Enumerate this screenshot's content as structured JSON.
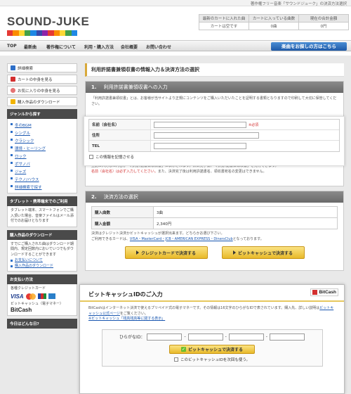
{
  "topline": "著作権フリー音楽「サウンドジューク」の決済方法選択",
  "logo": "SOUND-JUKE",
  "logo_colors": [
    "#e53935",
    "#fb8c00",
    "#fdd835",
    "#43a047",
    "#1e88e5",
    "#3949ab",
    "#8e24aa",
    "#e53935",
    "#fb8c00",
    "#fdd835",
    "#43a047",
    "#1e88e5"
  ],
  "status": {
    "headers": [
      "最新のカートに入れた曲",
      "カートに入っている曲数",
      "現在の合計金額"
    ],
    "values": [
      "カートは空です",
      "0曲",
      "0円"
    ]
  },
  "nav": {
    "items": [
      "TOP",
      "最新曲",
      "著作権について",
      "利用・購入方法",
      "会社概要",
      "お問い合わせ"
    ],
    "search": "楽曲をお探しの方はこちら"
  },
  "sidebar": {
    "buttons": [
      "詳細検索",
      "カートの中身を見る",
      "お気に入りの中身を見る",
      "購入作品のダウンロード"
    ],
    "genre_title": "ジャンルから探す",
    "genres": [
      "冬のBGM",
      "シングル",
      "クラシック",
      "環境・ヒーリング",
      "ロック",
      "ポサノバ",
      "ジャズ",
      "テクノ/ハウス",
      "詳細検索で探す"
    ],
    "tablet_title": "タブレット・携帯端末でのご利用",
    "tablet_text": "タブレット端末、スマートフォンでご購入頂いた場合、音楽ファイルはメール添付でのお届けとなります",
    "download_title": "購入作品のダウンロード",
    "download_text": "すでにご購入された曲はダウンロード期間内、規定回数内においていつでもダウンロードすることができます",
    "download_links": [
      "お支払いについて",
      "購入作品のダウンロード"
    ],
    "pay_title": "お支払い方法",
    "card_label": "各種クレジットカード",
    "visa": "VISA",
    "bitcash_label": "ビットキャッシュ（電子マネー）",
    "bitcash": "BitCash",
    "today_title": "今日はどんな日?"
  },
  "main": {
    "title": "利用許諾書兼領収書の情報入力＆決済方法の選択",
    "step1_num": "1.",
    "step1_title": "利用許諾書兼領収書への入力",
    "step1_desc": "「利用許諾書兼領収書」とは、お客様が当サイトより正規にコンテンツをご購入いただいたことを証明する書類となりますので印刷して大切に保管してください。",
    "form": {
      "name_label": "名前（会社名）",
      "required": "※必須",
      "address_label": "住所",
      "tel_label": "TEL",
      "remember_label": "この情報を記憶させる"
    },
    "step1_note": "上記に入力した内容が「利用許諾書兼領収書」に表示されます。決済完了後、「利用許諾書兼領収書」を発行できます。",
    "step1_note2_red": "名前（会社名）は必ず入力してください。",
    "step1_note2": "また、決済完了後は利用許諾書名、領収書宛名の変更はできません。",
    "step2_num": "2.",
    "step2_title": "決済方法の選択",
    "count_label": "購入曲数",
    "count_value": "3曲",
    "amount_label": "購入金額",
    "amount_value": "2,340円",
    "pay_note": "決済はクレジット決済かビットキャッシュが選択出来ます。どちらかお選び下さい。",
    "card_note_prefix": "ご利用できるカードは、",
    "card_note_cards": "VISA・MasterCard・JCB・AMERICAN EXPRESS・DinersClub",
    "card_note_suffix": "となっております。",
    "credit_button": "クレジットカードで決済する",
    "bitcash_button": "ビットキャッシュで決済する"
  },
  "popup": {
    "title": "ビットキャッシュIDのご入力",
    "logo": "BitCash",
    "text1": "BitCashはインターネット決済で使えるプリペイド式の電子マネーです。その情報は16文字のひらがなIDで表されています。購入先、詳しい説明は",
    "link1": "ビットキャッシュ公式ページ",
    "text1b": "をご覧ください。",
    "link2": "※ビットキャッシュ「残高残高等に関する表示」",
    "hira_label": "ひらがなID：",
    "dash": "-",
    "button": "ビットキャッシュで決済する",
    "save_label": "このビットキャッシュIDを次回も使う。"
  }
}
